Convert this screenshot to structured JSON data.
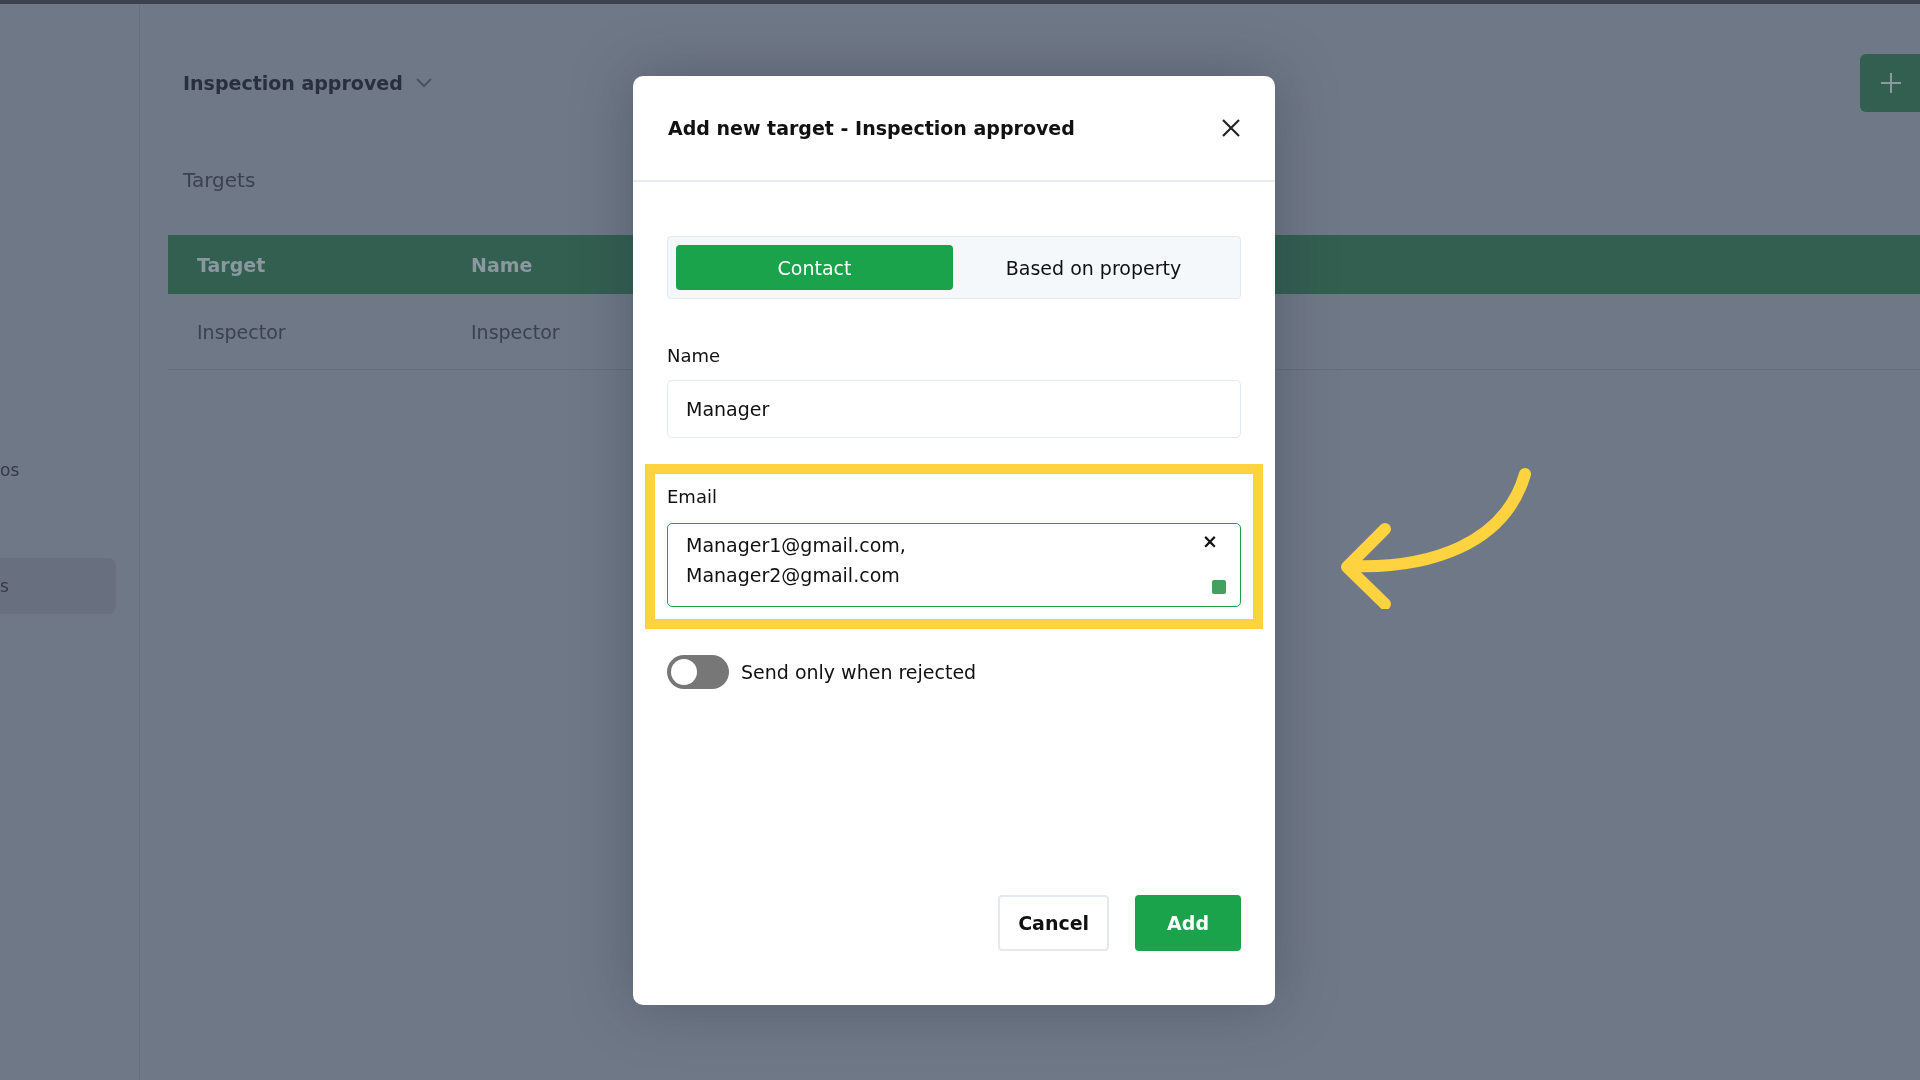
{
  "sidebar": {
    "items": [
      {
        "label": "os",
        "selected": false
      },
      {
        "label": "s",
        "selected": true
      }
    ]
  },
  "page": {
    "title": "Inspection approved",
    "section": "Targets"
  },
  "table": {
    "columns": [
      "Target",
      "Name"
    ],
    "rows": [
      [
        "Inspector",
        "Inspector"
      ]
    ]
  },
  "dialog": {
    "title": "Add new target - Inspection approved",
    "tabs": [
      {
        "label": "Contact",
        "selected": true
      },
      {
        "label": "Based on property",
        "selected": false
      }
    ],
    "name": {
      "label": "Name",
      "value": "Manager"
    },
    "email": {
      "label": "Email",
      "value": "Manager1@gmail.com,\nManager2@gmail.com",
      "clear": "×",
      "highlighted": true
    },
    "toggle": {
      "label": "Send only when rejected",
      "on": false
    },
    "buttons": [
      {
        "label": "Cancel",
        "kind": "secondary"
      },
      {
        "label": "Add",
        "kind": "primary"
      }
    ]
  }
}
